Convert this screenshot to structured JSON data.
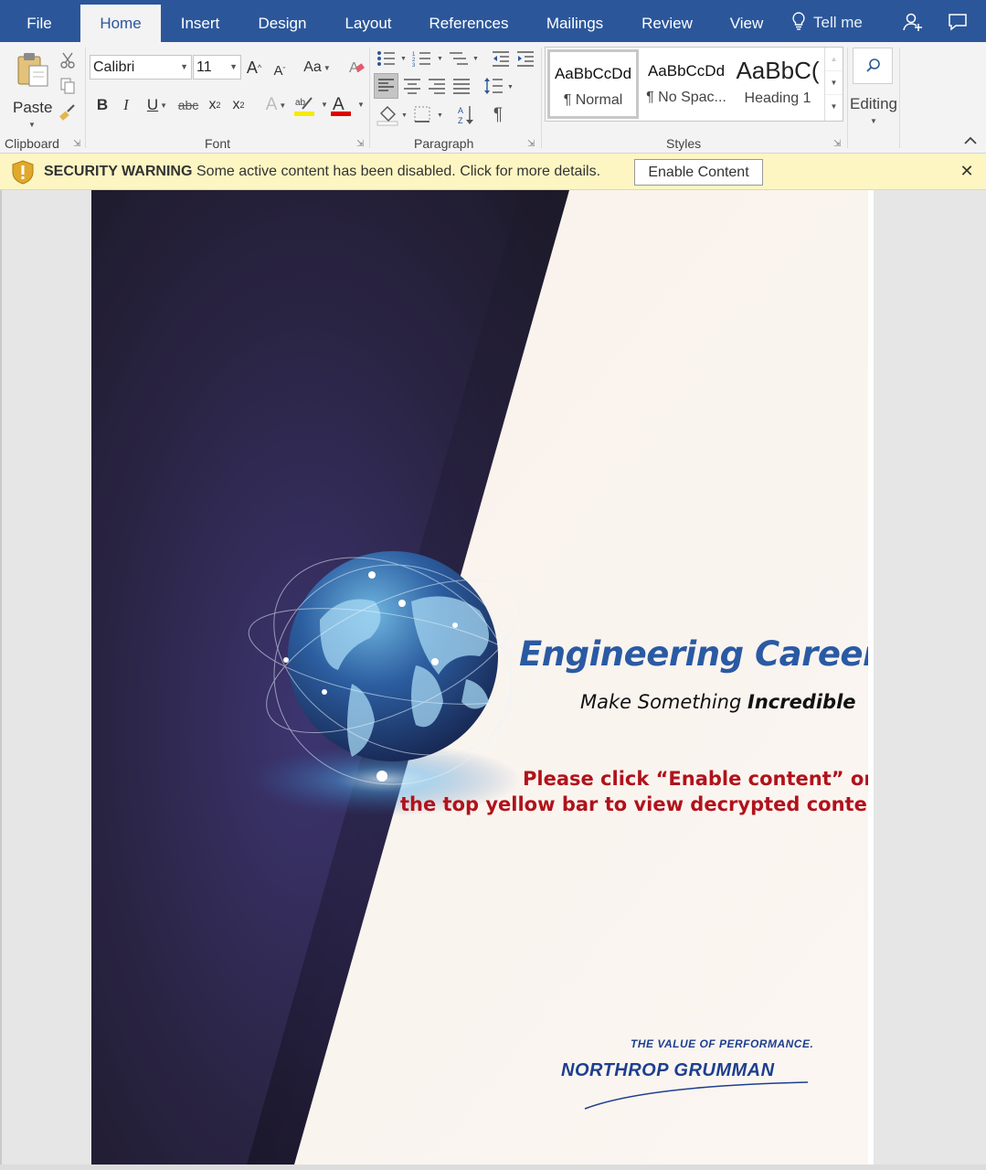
{
  "tabs": [
    {
      "label": "File",
      "active": false
    },
    {
      "label": "Home",
      "active": true
    },
    {
      "label": "Insert",
      "active": false
    },
    {
      "label": "Design",
      "active": false
    },
    {
      "label": "Layout",
      "active": false
    },
    {
      "label": "References",
      "active": false
    },
    {
      "label": "Mailings",
      "active": false
    },
    {
      "label": "Review",
      "active": false
    },
    {
      "label": "View",
      "active": false
    }
  ],
  "tell_me": "Tell me",
  "ribbon": {
    "clipboard": {
      "paste_label": "Paste",
      "group_label": "Clipboard"
    },
    "font": {
      "font_name": "Calibri",
      "font_size": "11",
      "group_label": "Font",
      "change_case_label": "Aa"
    },
    "paragraph": {
      "group_label": "Paragraph"
    },
    "styles": {
      "group_label": "Styles",
      "items": [
        {
          "preview": "AaBbCcDd",
          "name": "¶ Normal",
          "selected": true
        },
        {
          "preview": "AaBbCcDd",
          "name": "¶ No Spac...",
          "selected": false
        },
        {
          "preview": "AaBbC(",
          "name": "Heading 1",
          "selected": false
        }
      ]
    },
    "editing": {
      "label": "Editing"
    }
  },
  "security_bar": {
    "title": "SECURITY WARNING",
    "message": "Some active content has been disabled. Click for more details.",
    "button": "Enable Content",
    "close": "✕"
  },
  "document": {
    "headline": "Engineering Careers",
    "tagline_prefix": "Make Something ",
    "tagline_bold": "Incredible",
    "warning_line1": "Please click “Enable content” on",
    "warning_line2": "the top yellow bar to view decrypted contents.",
    "slogan": "THE VALUE OF PERFORMANCE.",
    "company": "NORTHROP GRUMMAN"
  },
  "colors": {
    "tab_bar": "#2b579a",
    "ribbon": "#f3f3f3",
    "security_bar": "#fdf6c3",
    "headline": "#2a5aa3",
    "warning_text": "#b1121b",
    "brand": "#1d3f8f"
  }
}
